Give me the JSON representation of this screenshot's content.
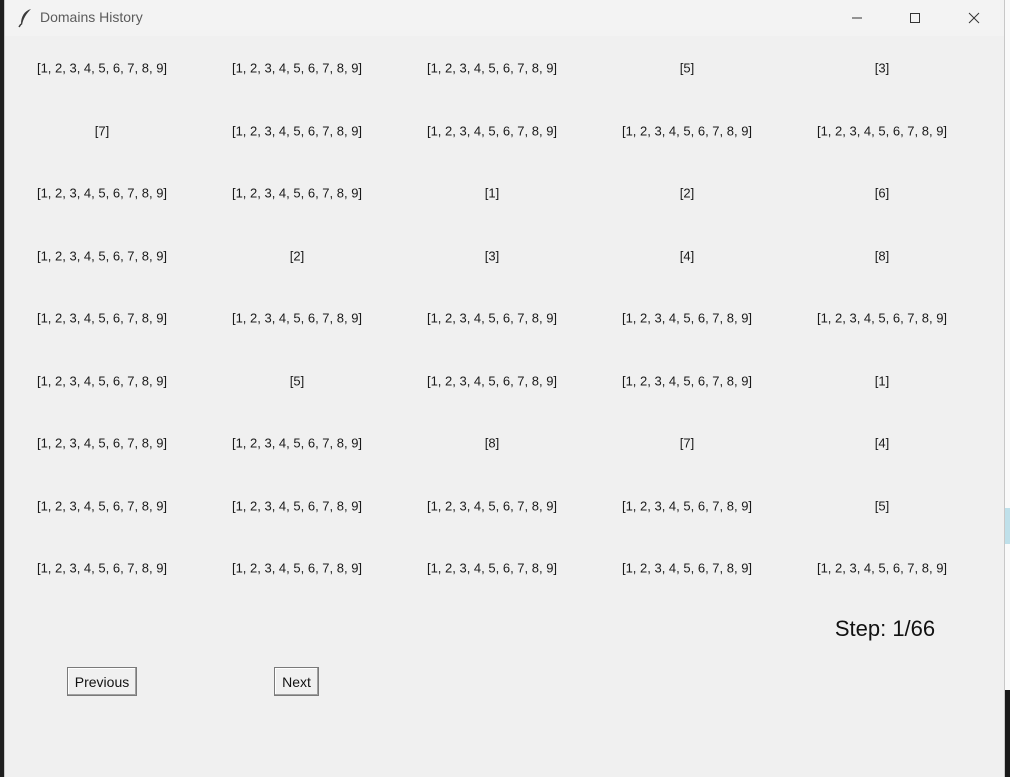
{
  "window": {
    "title": "Domains History"
  },
  "grid": {
    "rows": [
      [
        "[1, 2, 3, 4, 5, 6, 7, 8, 9]",
        "[1, 2, 3, 4, 5, 6, 7, 8, 9]",
        "[1, 2, 3, 4, 5, 6, 7, 8, 9]",
        "[5]",
        "[3]"
      ],
      [
        "[7]",
        "[1, 2, 3, 4, 5, 6, 7, 8, 9]",
        "[1, 2, 3, 4, 5, 6, 7, 8, 9]",
        "[1, 2, 3, 4, 5, 6, 7, 8, 9]",
        "[1, 2, 3, 4, 5, 6, 7, 8, 9]"
      ],
      [
        "[1, 2, 3, 4, 5, 6, 7, 8, 9]",
        "[1, 2, 3, 4, 5, 6, 7, 8, 9]",
        "[1]",
        "[2]",
        "[6]"
      ],
      [
        "[1, 2, 3, 4, 5, 6, 7, 8, 9]",
        "[2]",
        "[3]",
        "[4]",
        "[8]"
      ],
      [
        "[1, 2, 3, 4, 5, 6, 7, 8, 9]",
        "[1, 2, 3, 4, 5, 6, 7, 8, 9]",
        "[1, 2, 3, 4, 5, 6, 7, 8, 9]",
        "[1, 2, 3, 4, 5, 6, 7, 8, 9]",
        "[1, 2, 3, 4, 5, 6, 7, 8, 9]"
      ],
      [
        "[1, 2, 3, 4, 5, 6, 7, 8, 9]",
        "[5]",
        "[1, 2, 3, 4, 5, 6, 7, 8, 9]",
        "[1, 2, 3, 4, 5, 6, 7, 8, 9]",
        "[1]"
      ],
      [
        "[1, 2, 3, 4, 5, 6, 7, 8, 9]",
        "[1, 2, 3, 4, 5, 6, 7, 8, 9]",
        "[8]",
        "[7]",
        "[4]"
      ],
      [
        "[1, 2, 3, 4, 5, 6, 7, 8, 9]",
        "[1, 2, 3, 4, 5, 6, 7, 8, 9]",
        "[1, 2, 3, 4, 5, 6, 7, 8, 9]",
        "[1, 2, 3, 4, 5, 6, 7, 8, 9]",
        "[5]"
      ],
      [
        "[1, 2, 3, 4, 5, 6, 7, 8, 9]",
        "[1, 2, 3, 4, 5, 6, 7, 8, 9]",
        "[1, 2, 3, 4, 5, 6, 7, 8, 9]",
        "[1, 2, 3, 4, 5, 6, 7, 8, 9]",
        "[1, 2, 3, 4, 5, 6, 7, 8, 9]"
      ]
    ]
  },
  "status": {
    "step": "Step: 1/66"
  },
  "controls": {
    "previous_label": "Previous",
    "next_label": "Next"
  },
  "icons": {
    "app": "feather-icon",
    "minimize": "minimize-icon",
    "maximize": "maximize-icon",
    "close": "close-icon"
  }
}
